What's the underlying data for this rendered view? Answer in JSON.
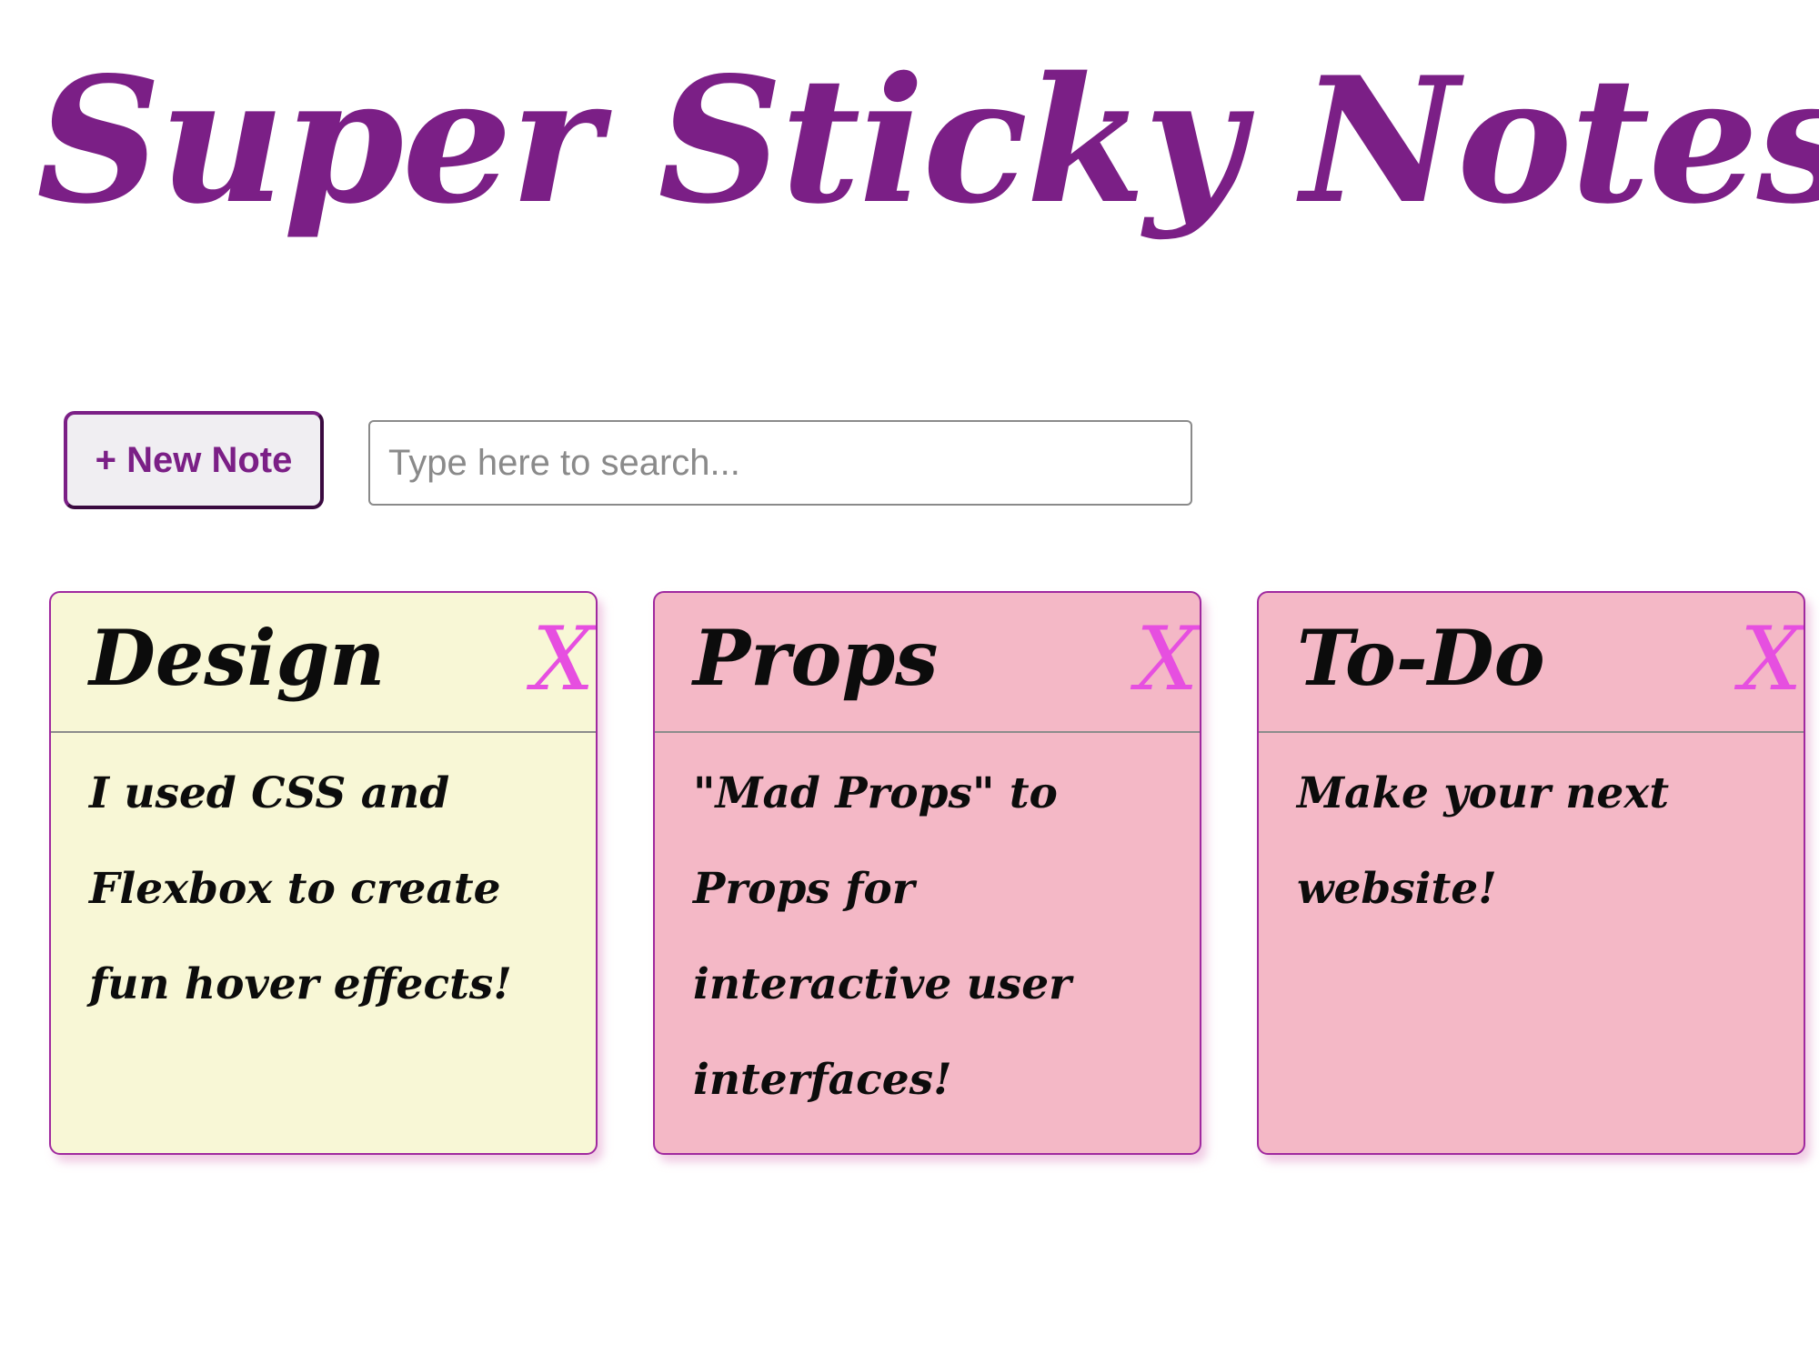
{
  "app": {
    "title": "Super Sticky Notes"
  },
  "toolbar": {
    "new_note_label": "+ New Note",
    "search_placeholder": "Type here to search...",
    "search_value": ""
  },
  "notes": [
    {
      "title": "Design",
      "body": "I used CSS and Flexbox to create fun hover effects!",
      "delete_label": "X",
      "color": "#f8f7d6"
    },
    {
      "title": "Props",
      "body": "\"Mad Props\" to Props for interactive user interfaces!",
      "delete_label": "X",
      "color": "#f4b8c6"
    },
    {
      "title": "To-Do",
      "body": "Make your next website!",
      "delete_label": "X",
      "color": "#f4b8c6"
    }
  ],
  "colors": {
    "title": "#7b1f86",
    "accent": "#7b1f86",
    "note_border": "#a0299f",
    "delete_icon": "#e64fe0"
  }
}
